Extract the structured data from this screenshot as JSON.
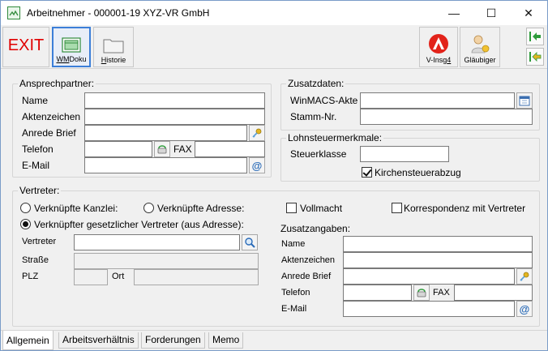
{
  "window": {
    "title": "Arbeitnehmer - 000001-19 XYZ-VR GmbH",
    "min": "—",
    "max": "☐",
    "close": "✕"
  },
  "toolbar": {
    "exit": "EXIT",
    "wmdoku_prefix": "WM",
    "wmdoku_rest": "Doku",
    "historie_prefix": "H",
    "historie_rest": "istorie",
    "vinsg_prefix": "V-Insg",
    "vinsg_suffix": "4",
    "glaeubiger": "Gläubiger"
  },
  "ansprechpartner": {
    "title": "Ansprechpartner:",
    "name_label": "Name",
    "name_value": "",
    "aktenzeichen_label": "Aktenzeichen",
    "aktenzeichen_value": "",
    "anrede_label": "Anrede Brief",
    "anrede_value": "",
    "telefon_label": "Telefon",
    "telefon_value": "",
    "fax_label": "FAX",
    "fax_value": "",
    "email_label": "E-Mail",
    "email_value": ""
  },
  "zusatzdaten": {
    "title": "Zusatzdaten:",
    "winmacs_label": "WinMACS-Akte",
    "winmacs_value": "",
    "stamm_label": "Stamm-Nr.",
    "stamm_value": ""
  },
  "lohnsteuer": {
    "title": "Lohnsteuermerkmale:",
    "steuerklasse_label": "Steuerklasse",
    "steuerklasse_value": "",
    "kirchensteuer_label": "Kirchensteuerabzug",
    "kirchensteuer_checked": true
  },
  "vertreter": {
    "title": "Vertreter:",
    "radio_kanzlei": "Verknüpfte Kanzlei:",
    "radio_adresse": "Verknüpfte Adresse:",
    "radio_gesetzlich": "Verknüpfter gesetzlicher Vertreter (aus Adresse):",
    "selected": "gesetzlich",
    "vollmacht_label": "Vollmacht",
    "vollmacht_checked": false,
    "korrespondenz_label": "Korrespondenz mit Vertreter",
    "korrespondenz_checked": false,
    "vertreter_label": "Vertreter",
    "vertreter_value": "",
    "strasse_label": "Straße",
    "plz_label": "PLZ",
    "ort_label": "Ort",
    "zusatzangaben_title": "Zusatzangaben:",
    "z_name_label": "Name",
    "z_aktenzeichen_label": "Aktenzeichen",
    "z_anrede_label": "Anrede Brief",
    "z_telefon_label": "Telefon",
    "z_fax_label": "FAX",
    "z_email_label": "E-Mail"
  },
  "tabs": [
    "Allgemein",
    "Arbeitsverhältnis",
    "Forderungen",
    "Memo"
  ],
  "colors": {
    "exit_red": "#e00000",
    "accent_blue": "#3c7fd8",
    "arrow_green": "#2d9b3a"
  }
}
